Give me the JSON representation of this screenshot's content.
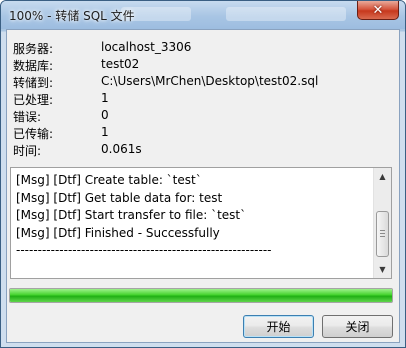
{
  "window": {
    "title": "100% - 转储 SQL 文件",
    "close_glyph": "✕"
  },
  "info": [
    {
      "label": "服务器:",
      "value": "localhost_3306"
    },
    {
      "label": "数据库:",
      "value": "test02"
    },
    {
      "label": "转储到:",
      "value": "C:\\Users\\MrChen\\Desktop\\test02.sql"
    },
    {
      "label": "已处理:",
      "value": "1"
    },
    {
      "label": "错误:",
      "value": "0"
    },
    {
      "label": "已传输:",
      "value": "1"
    },
    {
      "label": "时间:",
      "value": "0.061s"
    }
  ],
  "log": {
    "lines": [
      "[Msg] [Dtf] Create table: `test`",
      "[Msg] [Dtf] Get table data for: test",
      "[Msg] [Dtf] Start transfer to file: `test`",
      "[Msg] [Dtf] Finished - Successfully",
      "-----------------------------------------------------------"
    ],
    "scroll_up_glyph": "▲",
    "scroll_down_glyph": "▼"
  },
  "progress": {
    "percent": 100,
    "color": "#2fc21c"
  },
  "buttons": {
    "start_label": "开始",
    "close_label": "关闭"
  },
  "colors": {
    "title_bar": "#a8c5e4",
    "close_button": "#c7381d",
    "dialog_bg": "#f0f0f0",
    "button_focus_border": "#3c7fb1"
  }
}
